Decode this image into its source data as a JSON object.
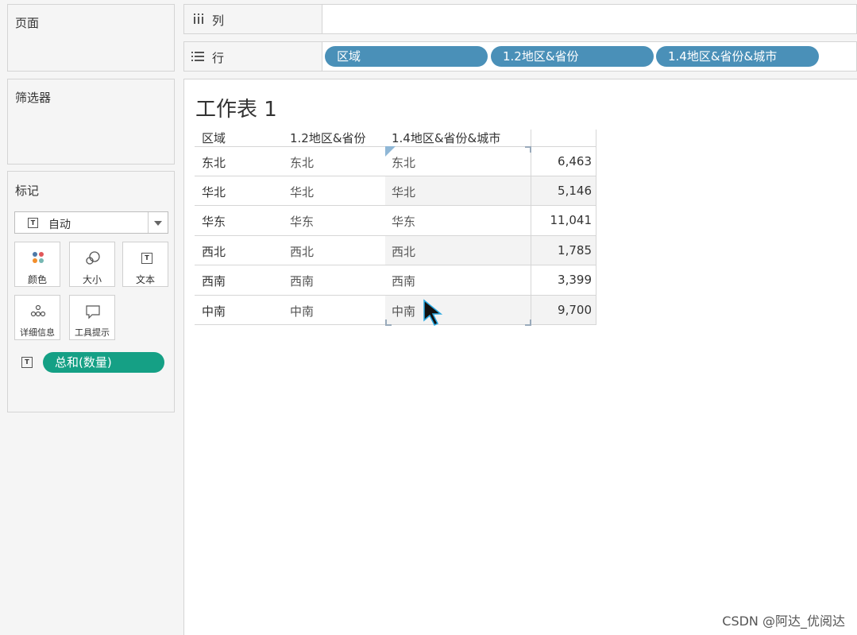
{
  "left_panel": {
    "pages_title": "页面",
    "filters_title": "筛选器",
    "marks_title": "标记",
    "marks_type": "自动",
    "mark_buttons": {
      "color": "颜色",
      "size": "大小",
      "text": "文本",
      "detail": "详细信息",
      "tooltip": "工具提示"
    },
    "measure_pill": "总和(数量)"
  },
  "shelves": {
    "columns_label": "列",
    "rows_label": "行",
    "row_pills": [
      "区域",
      "1.2地区&省份",
      "1.4地区&省份&城市"
    ]
  },
  "sheet": {
    "title": "工作表 1",
    "headers": [
      "区域",
      "1.2地区&省份",
      "1.4地区&省份&城市"
    ],
    "rows": [
      {
        "region": "东北",
        "province": "东北",
        "city": "东北",
        "value": "6,463"
      },
      {
        "region": "华北",
        "province": "华北",
        "city": "华北",
        "value": "5,146"
      },
      {
        "region": "华东",
        "province": "华东",
        "city": "华东",
        "value": "11,041"
      },
      {
        "region": "西北",
        "province": "西北",
        "city": "西北",
        "value": "1,785"
      },
      {
        "region": "西南",
        "province": "西南",
        "city": "西南",
        "value": "3,399"
      },
      {
        "region": "中南",
        "province": "中南",
        "city": "中南",
        "value": "9,700"
      }
    ]
  },
  "colors": {
    "dimension_pill": "#4a90b8",
    "measure_pill": "#15a085"
  },
  "watermark": "CSDN @阿达_优阅达"
}
